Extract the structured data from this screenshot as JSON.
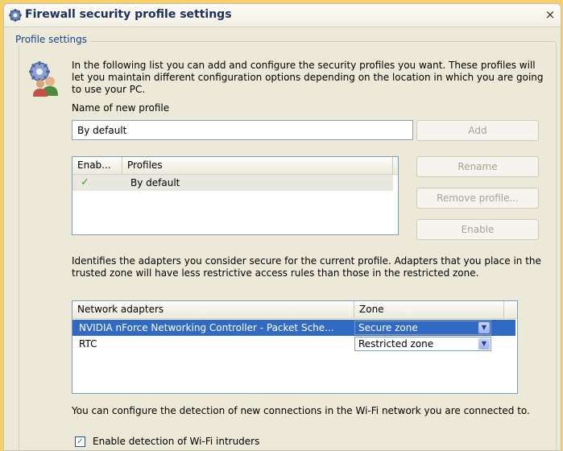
{
  "window": {
    "title": "Firewall security profile settings",
    "close_label": "×"
  },
  "group": {
    "legend": "Profile settings",
    "intro_text": "In the following list you can add and configure the security profiles you want. These profiles will let you maintain different configuration options depending on the location in which you are going to use your PC.",
    "new_profile_label": "Name of new profile",
    "new_profile_value": "By default"
  },
  "buttons": {
    "add": "Add",
    "rename": "Rename",
    "remove": "Remove profile...",
    "enable": "Enable"
  },
  "profiles": {
    "columns": [
      "Enab...",
      "Profiles"
    ],
    "rows": [
      {
        "enabled_icon": "✓",
        "name": "By default"
      }
    ]
  },
  "adapters": {
    "description": "Identifies the adapters you consider secure for the current profile. Adapters that you place in the trusted zone will have less restrictive access rules than those in the restricted zone.",
    "columns": [
      "Network adapters",
      "Zone"
    ],
    "rows": [
      {
        "name": "NVIDIA nForce Networking Controller - Packet Sche...",
        "zone": "Secure zone"
      },
      {
        "name": "RTC",
        "zone": "Restricted zone"
      }
    ]
  },
  "wifi": {
    "description": "You can configure the detection of new connections in the Wi-Fi network you are connected to.",
    "checkbox_label": "Enable detection of Wi-Fi intruders",
    "checkbox_checked": true,
    "check_mark": "✓"
  },
  "colors": {
    "selection": "#316ac5",
    "background": "#ece9d8",
    "frame": "#f6cf6a"
  }
}
